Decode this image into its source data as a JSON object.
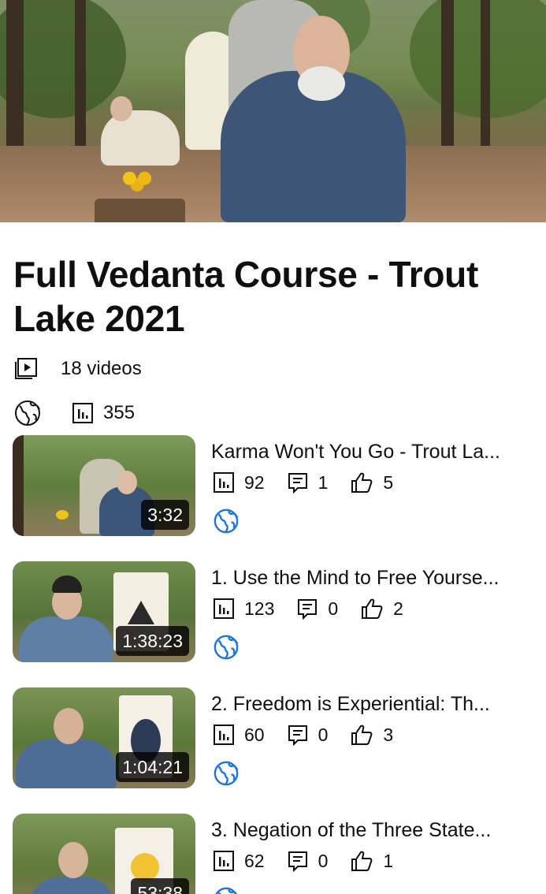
{
  "playlist": {
    "title": "Full Vedanta Course - Trout Lake 2021",
    "video_count": "18 videos",
    "views": "355",
    "visibility_icon": "globe-icon"
  },
  "videos": [
    {
      "title": "Karma Won't You Go - Trout La...",
      "duration": "3:32",
      "views": "92",
      "comments": "1",
      "likes": "5"
    },
    {
      "title": "1. Use the Mind to Free Yourse...",
      "duration": "1:38:23",
      "views": "123",
      "comments": "0",
      "likes": "2"
    },
    {
      "title": "2. Freedom is Experiential: Th...",
      "duration": "1:04:21",
      "views": "60",
      "comments": "0",
      "likes": "3"
    },
    {
      "title": "3. Negation of the Three State...",
      "duration": "53:38",
      "views": "62",
      "comments": "0",
      "likes": "1"
    }
  ],
  "colors": {
    "icon_blue": "#1a73e8",
    "text": "#0f0f0f"
  }
}
